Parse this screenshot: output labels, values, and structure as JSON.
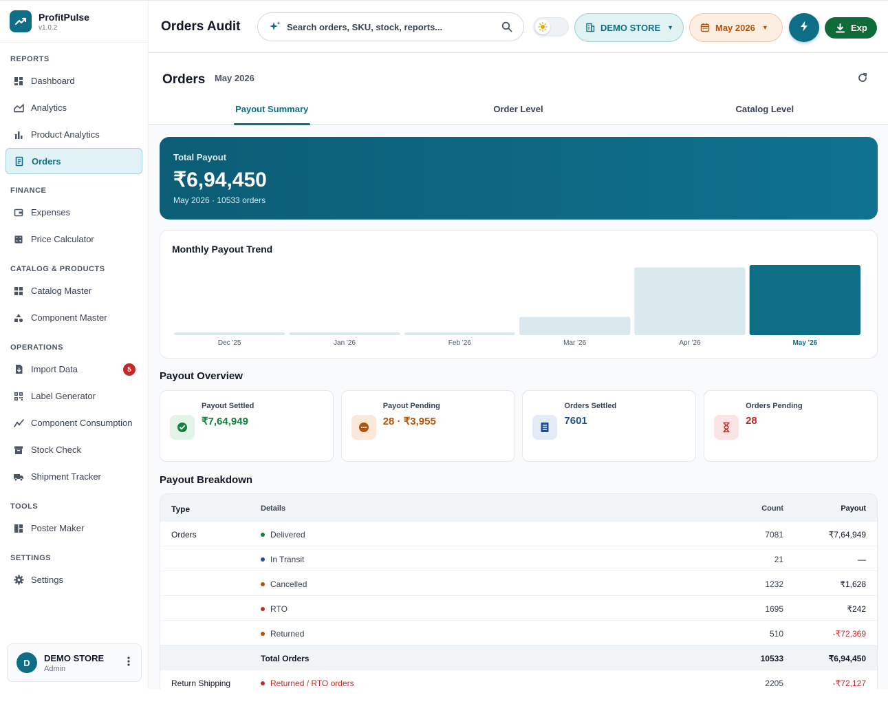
{
  "brand": {
    "name": "ProfitPulse",
    "version": "v1.0.2"
  },
  "sidebar": {
    "sections": [
      {
        "title": "REPORTS",
        "items": [
          {
            "label": "Dashboard",
            "icon": "dashboard-icon"
          },
          {
            "label": "Analytics",
            "icon": "analytics-icon"
          },
          {
            "label": "Product Analytics",
            "icon": "bar-chart-icon"
          },
          {
            "label": "Orders",
            "icon": "receipt-icon",
            "active": true
          }
        ]
      },
      {
        "title": "FINANCE",
        "items": [
          {
            "label": "Expenses",
            "icon": "wallet-icon"
          },
          {
            "label": "Price Calculator",
            "icon": "calculator-icon"
          }
        ]
      },
      {
        "title": "CATALOG & PRODUCTS",
        "items": [
          {
            "label": "Catalog Master",
            "icon": "grid-icon"
          },
          {
            "label": "Component Master",
            "icon": "shapes-icon"
          }
        ]
      },
      {
        "title": "OPERATIONS",
        "items": [
          {
            "label": "Import Data",
            "icon": "file-import-icon",
            "badge": "5"
          },
          {
            "label": "Label Generator",
            "icon": "qr-code-icon"
          },
          {
            "label": "Component Consumption",
            "icon": "trend-line-icon"
          },
          {
            "label": "Stock Check",
            "icon": "archive-box-icon"
          },
          {
            "label": "Shipment Tracker",
            "icon": "truck-icon"
          }
        ]
      },
      {
        "title": "TOOLS",
        "items": [
          {
            "label": "Poster Maker",
            "icon": "layout-icon"
          }
        ]
      },
      {
        "title": "SETTINGS",
        "items": [
          {
            "label": "Settings",
            "icon": "gear-icon"
          }
        ]
      }
    ]
  },
  "user": {
    "initial": "D",
    "name": "DEMO STORE",
    "role": "Admin"
  },
  "topbar": {
    "title": "Orders Audit",
    "search_placeholder": "Search orders, SKU, stock, reports...",
    "store": "DEMO STORE",
    "period": "May 2026",
    "export_label": "Exp"
  },
  "orders": {
    "title": "Orders",
    "subtitle": "May 2026",
    "tabs": [
      "Payout Summary",
      "Order Level",
      "Catalog Level"
    ]
  },
  "banner": {
    "label": "Total Payout",
    "value": "₹6,94,450",
    "sub": "May 2026 · 10533 orders"
  },
  "chart_data": {
    "type": "bar",
    "title": "Monthly Payout Trend",
    "categories": [
      "Dec '25",
      "Jan '26",
      "Feb '26",
      "Mar '26",
      "Apr '26",
      "May '26"
    ],
    "values": [
      0,
      0,
      0,
      180000,
      670000,
      694450
    ],
    "highlight_index": 5,
    "colors": {
      "bar": "#d9e9ee",
      "highlight": "#0e6e86"
    }
  },
  "overview": {
    "title": "Payout Overview",
    "cards": [
      {
        "label": "Payout Settled",
        "value": "₹7,64,949",
        "color": "#15803d",
        "bg": "#e3f3e8",
        "icon": "check-circle-icon"
      },
      {
        "label": "Payout Pending",
        "value": "28 · ₹3,955",
        "color": "#b45309",
        "bg": "#fbe8d9",
        "icon": "pending-dots-icon"
      },
      {
        "label": "Orders Settled",
        "value": "7601",
        "color": "#1d4f91",
        "bg": "#e3ecf6",
        "icon": "document-icon"
      },
      {
        "label": "Orders Pending",
        "value": "28",
        "color": "#c62828",
        "bg": "#fbe4e4",
        "icon": "hourglass-icon"
      }
    ]
  },
  "breakdown": {
    "title": "Payout Breakdown",
    "headers": {
      "type": "Type",
      "details": "Details",
      "count": "Count",
      "payout": "Payout"
    },
    "rows": [
      {
        "type": "Orders",
        "detail": "Delivered",
        "dot": "#15803d",
        "count": "7081",
        "payout": "₹7,64,949"
      },
      {
        "type": "",
        "detail": "In Transit",
        "dot": "#1d4f91",
        "count": "21",
        "payout": "—"
      },
      {
        "type": "",
        "detail": "Cancelled",
        "dot": "#b45309",
        "count": "1232",
        "payout": "₹1,628"
      },
      {
        "type": "",
        "detail": "RTO",
        "dot": "#c62828",
        "count": "1695",
        "payout": "₹242"
      },
      {
        "type": "",
        "detail": "Returned",
        "dot": "#b45309",
        "count": "510",
        "payout": "-₹72,369",
        "negative": true
      },
      {
        "type": "",
        "detail": "Total Orders",
        "count": "10533",
        "payout": "₹6,94,450",
        "total": true
      },
      {
        "type": "Return Shipping",
        "detail": "Returned / RTO orders",
        "dot": "#c62828",
        "count": "2205",
        "payout": "-₹72,127",
        "negative": true,
        "detail_red": true
      }
    ]
  }
}
